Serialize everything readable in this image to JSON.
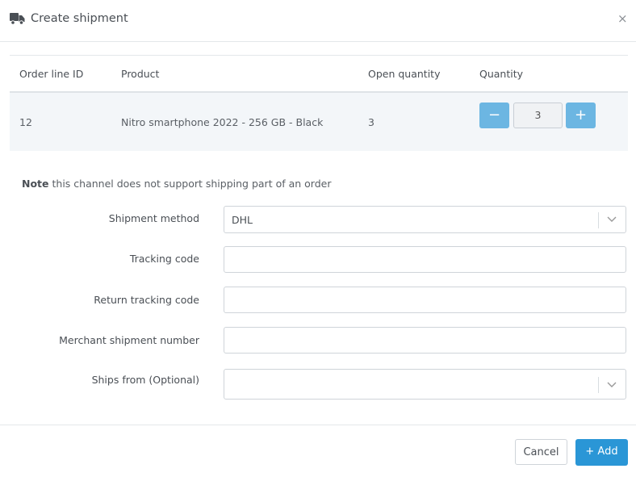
{
  "modal": {
    "title": "Create shipment",
    "truck_icon": "truck-icon",
    "close_icon": "close-icon",
    "close_glyph": "×"
  },
  "table": {
    "headers": [
      "Order line ID",
      "Product",
      "Open quantity",
      "Quantity"
    ],
    "rows": [
      {
        "order_line_id": "12",
        "product": "Nitro smartphone 2022 - 256 GB - Black",
        "open_quantity": "3",
        "quantity": "3"
      }
    ],
    "minus_glyph": "−",
    "plus_glyph": "+"
  },
  "note": {
    "bold": "Note",
    "text": " this channel does not support shipping part of an order"
  },
  "form": {
    "shipment_method": {
      "label": "Shipment method",
      "value": "DHL"
    },
    "tracking_code": {
      "label": "Tracking code",
      "value": ""
    },
    "return_tracking_code": {
      "label": "Return tracking code",
      "value": ""
    },
    "merchant_shipment_number": {
      "label": "Merchant shipment number",
      "value": ""
    },
    "ships_from": {
      "label": "Ships from (Optional)",
      "value": ""
    }
  },
  "footer": {
    "cancel_label": "Cancel",
    "add_label": "+ Add"
  },
  "colors": {
    "primary": "#2a96d6",
    "stepper": "#6cb6e2",
    "row_bg": "#f3f6f9"
  }
}
